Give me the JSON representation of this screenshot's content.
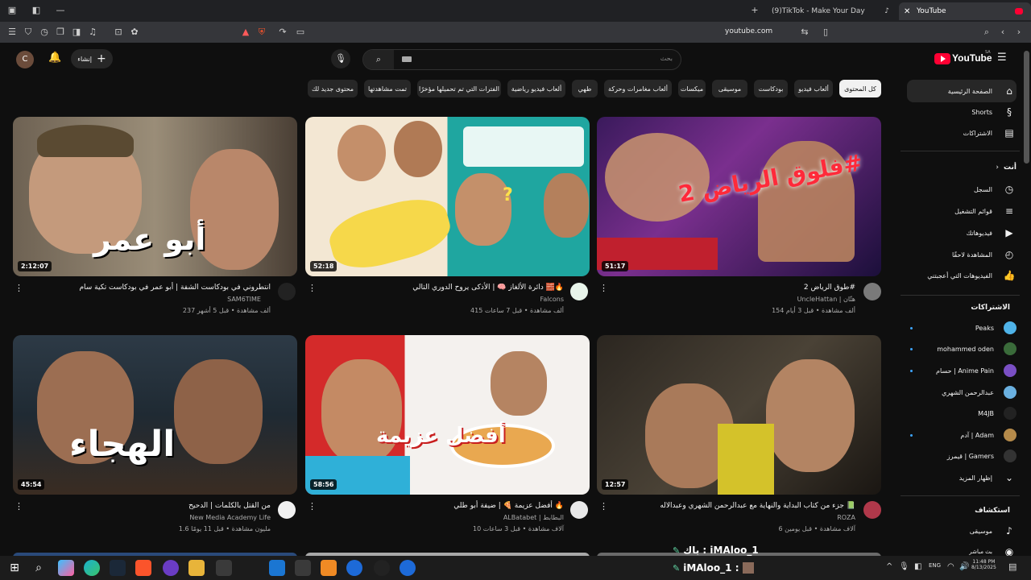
{
  "browser": {
    "tabs": [
      {
        "label": "(9)TikTok - Make Your Day"
      },
      {
        "label": "YouTube"
      }
    ],
    "address": "youtube.com"
  },
  "youtube": {
    "logo": "YouTube",
    "logo_sup": "SA",
    "search_placeholder": "بحث",
    "create_label": "إنشاء",
    "user_initial": "C",
    "chips": [
      "كل المحتوى",
      "ألعاب فيديو",
      "بودكاست",
      "موسيقى",
      "ميكسات",
      "ألعاب مغامرات وحركة",
      "طهي",
      "ألعاب فيديو رياضية",
      "الفترات التي تم تحميلها مؤخرًا",
      "تمت مشاهدتها",
      "محتوى جديد لك"
    ],
    "videos": [
      {
        "title": "طوق الرياض 2#",
        "channel": "UncleHattan | هتّان",
        "meta": "154 ألف مشاهدة • قبل 3 أيام",
        "duration": "51:17",
        "thumb_text": "فلوق الرياض 2#"
      },
      {
        "title": "دائرة الألغاز 🧠 | الأذكى يروح الدوري التالي 🧱🔥",
        "channel": "Falcons",
        "meta": "415 ألف مشاهدة • قبل 7 ساعات",
        "duration": "52:18",
        "thumb_text": "?"
      },
      {
        "title": "انتطروني في بودكاست الشفة | أبو عمر في بودكاست تكية سام",
        "channel": "SAM6TIME",
        "meta": "237 ألف مشاهدة • قبل 5 أشهر",
        "duration": "2:12:07",
        "thumb_text": "أبو عمر"
      },
      {
        "title": "جزء من كتاب البداية والنهاية مع عبدالرحمن الشهري وعبدالاله 📗",
        "channel": "ROZA",
        "meta": "6 آلاف مشاهدة • قبل يومين",
        "duration": "12:57",
        "thumb_text": ""
      },
      {
        "title": "أفضل عزيمة 🍕 | ضيفة أبو طلي 🔥",
        "channel": "ALBatabet | البطابط",
        "meta": "10 آلاف مشاهدة • قبل 3 ساعات",
        "duration": "58:56",
        "thumb_text": "أفضل عزيمة"
      },
      {
        "title": "من القتل بالكلمات | الدحيح",
        "channel": "New Media Academy Life",
        "meta": "1.6 مليون مشاهدة • قبل 11 يومًا",
        "duration": "45:54",
        "thumb_text": "الهجاء"
      }
    ],
    "sidebar": {
      "main": [
        {
          "label": "الصفحة الرئيسية",
          "icon": "home-icon"
        },
        {
          "label": "Shorts",
          "icon": "shorts-icon"
        },
        {
          "label": "الاشتراكات",
          "icon": "subscriptions-icon"
        }
      ],
      "you_title": "أنت",
      "you": [
        {
          "label": "السجل",
          "icon": "history-icon"
        },
        {
          "label": "قوائم التشغيل",
          "icon": "playlists-icon"
        },
        {
          "label": "فيديوهاتك",
          "icon": "your-videos-icon"
        },
        {
          "label": "المشاهدة لاحقًا",
          "icon": "watch-later-icon"
        },
        {
          "label": "الفيديوهات التي أعجبتني",
          "icon": "liked-icon"
        }
      ],
      "subs_title": "الاشتراكات",
      "subs": [
        {
          "label": "Peaks",
          "color": "#4fb3e8"
        },
        {
          "label": "mohammed oden",
          "color": "#3a6b3a"
        },
        {
          "label": "حسام | Anime Pain",
          "color": "#7a4fc4"
        },
        {
          "label": "عبدالرحمن الشهري",
          "color": "#6ab0e0"
        },
        {
          "label": "M4JB",
          "color": "#222222"
        },
        {
          "label": "آدم | Adam",
          "color": "#b58a4a"
        },
        {
          "label": "قيمرز | Gamers",
          "color": "#333333"
        },
        {
          "label": "إظهار المزيد",
          "color": ""
        }
      ],
      "explore_title": "استكشاف",
      "explore": [
        {
          "label": "موسيقى",
          "icon": "music-icon"
        },
        {
          "label": "بث مباشر",
          "icon": "live-icon"
        }
      ]
    }
  },
  "overlay": {
    "chat1": "باك : iMAloo_1",
    "chat2": "iMAloo_1 :"
  },
  "taskbar": {
    "lang": "ENG",
    "time": "11:48 PM",
    "date": "8/13/2025"
  }
}
